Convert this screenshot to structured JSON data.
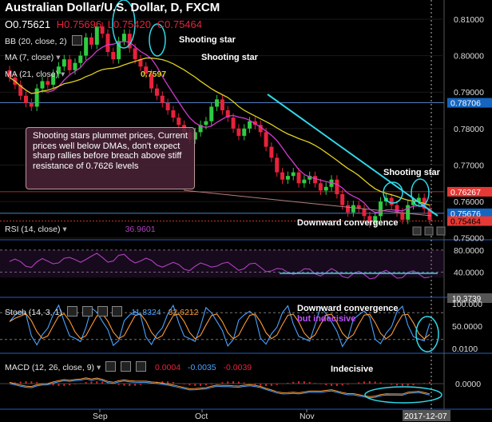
{
  "header": {
    "title": "Australian Dollar/U.S. Dollar, D, FXCM",
    "ohlc": [
      "O0.75621",
      "H0.75696",
      "L0.75420",
      "C0.75464"
    ]
  },
  "price_pane": {
    "bb_label": "BB (20, close, 2)",
    "ma7_label": "MA (7, close)",
    "ma21_label": "MA (21, close)",
    "ma21_value": "0.7597",
    "note": "Shooting stars plummet prices, Current prices well below DMAs, don't expect sharp rallies before breach above stiff resistance of 0.7626 levels",
    "annotations": [
      "Shooting star",
      "Shooting star",
      "Shooting star"
    ],
    "axis_ticks": [
      "0.81000",
      "0.80000",
      "0.79000",
      "0.78000",
      "0.77000",
      "0.76000",
      "0.75000"
    ],
    "price_tags": [
      {
        "text": "0.78706",
        "bg": "#1565c0",
        "fg": "#ffffff"
      },
      {
        "text": "0.76267",
        "bg": "#e53935",
        "fg": "#ffffff"
      },
      {
        "text": "0.75676",
        "bg": "#1565c0",
        "fg": "#ffffff"
      },
      {
        "text": "0.75464",
        "bg": "#e53935",
        "fg": "#000000"
      }
    ]
  },
  "rsi_pane": {
    "label": "RSI (14, close)",
    "value": "36.9601",
    "annotation": "Downward convergence",
    "axis_ticks": [
      "80.0000",
      "40.0000"
    ],
    "tag": "10.3739"
  },
  "stoch_pane": {
    "label": "Stoch (14, 3, 1)",
    "k": "11.8324",
    "d": "32.6212",
    "annotation1": "Downward convergence",
    "annotation2": "but indecisive",
    "axis_ticks": [
      "100.000",
      "50.0000",
      "0.0100"
    ]
  },
  "macd_pane": {
    "label": "MACD (12, 26, close, 9)",
    "v1": "0.0004",
    "v2": "-0.0035",
    "v3": "-0.0039",
    "annotation": "Indecisive",
    "axis_ticks": [
      "0.0000"
    ]
  },
  "x_axis": {
    "labels": [
      "Sep",
      "Oct",
      "Nov"
    ],
    "current_date": "2017-12-07"
  },
  "colors": {
    "bull": "#2ecc40",
    "bear": "#e8223c",
    "ma7": "#d23ad0",
    "ma21": "#e0d020",
    "rsi": "#b040c0",
    "stoch_k": "#4aa3ff",
    "stoch_d": "#ff9933",
    "macd_hist": "#d02828",
    "trend": "#30d8e8"
  },
  "chart_data": {
    "type": "candlestick",
    "ylim": [
      0.7495,
      0.8135
    ],
    "series_close": [
      0.794,
      0.792,
      0.789,
      0.787,
      0.786,
      0.791,
      0.793,
      0.792,
      0.795,
      0.797,
      0.799,
      0.796,
      0.798,
      0.8,
      0.805,
      0.803,
      0.808,
      0.806,
      0.801,
      0.799,
      0.804,
      0.806,
      0.802,
      0.799,
      0.797,
      0.795,
      0.791,
      0.789,
      0.787,
      0.785,
      0.783,
      0.781,
      0.779,
      0.777,
      0.779,
      0.781,
      0.782,
      0.786,
      0.788,
      0.785,
      0.783,
      0.78,
      0.778,
      0.78,
      0.782,
      0.781,
      0.779,
      0.775,
      0.772,
      0.768,
      0.766,
      0.767,
      0.768,
      0.765,
      0.766,
      0.767,
      0.765,
      0.763,
      0.764,
      0.766,
      0.762,
      0.759,
      0.757,
      0.759,
      0.758,
      0.756,
      0.754,
      0.756,
      0.76,
      0.761,
      0.759,
      0.757,
      0.755,
      0.759,
      0.76,
      0.761,
      0.758,
      0.755
    ]
  }
}
